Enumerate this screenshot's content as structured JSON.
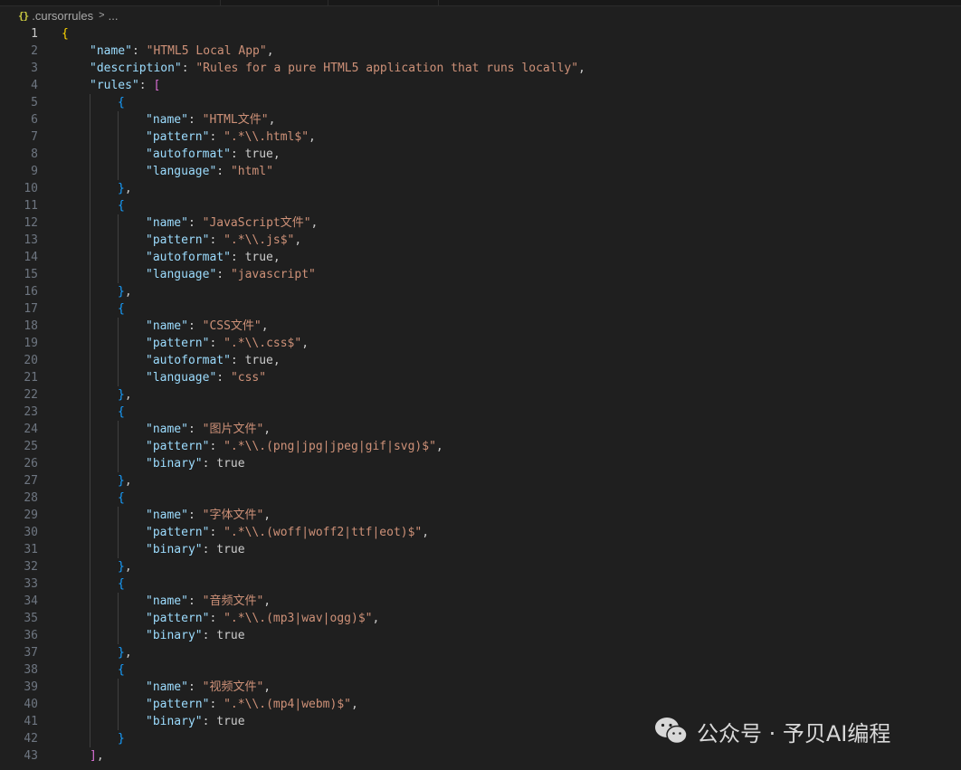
{
  "breadcrumb": {
    "file_icon": "{}",
    "file_name": ".cursorrules",
    "separator_icon": "chevron-right-icon",
    "ellipsis": "..."
  },
  "colors": {
    "background": "#1f1f1f",
    "key": "#9cdcfe",
    "string": "#ce9178",
    "bracket_level1": "#ffd700",
    "bracket_level2": "#da70d6",
    "bracket_level3": "#179fff"
  },
  "editor": {
    "active_line": 1,
    "lines": [
      {
        "n": "1",
        "indent": 0,
        "t": [
          {
            "c": "b1",
            "v": "{"
          }
        ]
      },
      {
        "n": "2",
        "indent": 1,
        "t": [
          {
            "c": "k",
            "v": "\"name\""
          },
          {
            "c": "p",
            "v": ": "
          },
          {
            "c": "s",
            "v": "\"HTML5 Local App\""
          },
          {
            "c": "p",
            "v": ","
          }
        ]
      },
      {
        "n": "3",
        "indent": 1,
        "t": [
          {
            "c": "k",
            "v": "\"description\""
          },
          {
            "c": "p",
            "v": ": "
          },
          {
            "c": "s",
            "v": "\"Rules for a pure HTML5 application that runs locally\""
          },
          {
            "c": "p",
            "v": ","
          }
        ]
      },
      {
        "n": "4",
        "indent": 1,
        "t": [
          {
            "c": "k",
            "v": "\"rules\""
          },
          {
            "c": "p",
            "v": ": "
          },
          {
            "c": "b2",
            "v": "["
          }
        ]
      },
      {
        "n": "5",
        "indent": 2,
        "t": [
          {
            "c": "b3",
            "v": "{"
          }
        ]
      },
      {
        "n": "6",
        "indent": 3,
        "t": [
          {
            "c": "k",
            "v": "\"name\""
          },
          {
            "c": "p",
            "v": ": "
          },
          {
            "c": "s",
            "v": "\"HTML文件\""
          },
          {
            "c": "p",
            "v": ","
          }
        ]
      },
      {
        "n": "7",
        "indent": 3,
        "t": [
          {
            "c": "k",
            "v": "\"pattern\""
          },
          {
            "c": "p",
            "v": ": "
          },
          {
            "c": "s",
            "v": "\".*\\\\.html$\""
          },
          {
            "c": "p",
            "v": ","
          }
        ]
      },
      {
        "n": "8",
        "indent": 3,
        "t": [
          {
            "c": "k",
            "v": "\"autoformat\""
          },
          {
            "c": "p",
            "v": ": "
          },
          {
            "c": "kw",
            "v": "true"
          },
          {
            "c": "p",
            "v": ","
          }
        ]
      },
      {
        "n": "9",
        "indent": 3,
        "t": [
          {
            "c": "k",
            "v": "\"language\""
          },
          {
            "c": "p",
            "v": ": "
          },
          {
            "c": "s",
            "v": "\"html\""
          }
        ]
      },
      {
        "n": "10",
        "indent": 2,
        "t": [
          {
            "c": "b3",
            "v": "}"
          },
          {
            "c": "p",
            "v": ","
          }
        ]
      },
      {
        "n": "11",
        "indent": 2,
        "t": [
          {
            "c": "b3",
            "v": "{"
          }
        ]
      },
      {
        "n": "12",
        "indent": 3,
        "t": [
          {
            "c": "k",
            "v": "\"name\""
          },
          {
            "c": "p",
            "v": ": "
          },
          {
            "c": "s",
            "v": "\"JavaScript文件\""
          },
          {
            "c": "p",
            "v": ","
          }
        ]
      },
      {
        "n": "13",
        "indent": 3,
        "t": [
          {
            "c": "k",
            "v": "\"pattern\""
          },
          {
            "c": "p",
            "v": ": "
          },
          {
            "c": "s",
            "v": "\".*\\\\.js$\""
          },
          {
            "c": "p",
            "v": ","
          }
        ]
      },
      {
        "n": "14",
        "indent": 3,
        "t": [
          {
            "c": "k",
            "v": "\"autoformat\""
          },
          {
            "c": "p",
            "v": ": "
          },
          {
            "c": "kw",
            "v": "true"
          },
          {
            "c": "p",
            "v": ","
          }
        ]
      },
      {
        "n": "15",
        "indent": 3,
        "t": [
          {
            "c": "k",
            "v": "\"language\""
          },
          {
            "c": "p",
            "v": ": "
          },
          {
            "c": "s",
            "v": "\"javascript\""
          }
        ]
      },
      {
        "n": "16",
        "indent": 2,
        "t": [
          {
            "c": "b3",
            "v": "}"
          },
          {
            "c": "p",
            "v": ","
          }
        ]
      },
      {
        "n": "17",
        "indent": 2,
        "t": [
          {
            "c": "b3",
            "v": "{"
          }
        ]
      },
      {
        "n": "18",
        "indent": 3,
        "t": [
          {
            "c": "k",
            "v": "\"name\""
          },
          {
            "c": "p",
            "v": ": "
          },
          {
            "c": "s",
            "v": "\"CSS文件\""
          },
          {
            "c": "p",
            "v": ","
          }
        ]
      },
      {
        "n": "19",
        "indent": 3,
        "t": [
          {
            "c": "k",
            "v": "\"pattern\""
          },
          {
            "c": "p",
            "v": ": "
          },
          {
            "c": "s",
            "v": "\".*\\\\.css$\""
          },
          {
            "c": "p",
            "v": ","
          }
        ]
      },
      {
        "n": "20",
        "indent": 3,
        "t": [
          {
            "c": "k",
            "v": "\"autoformat\""
          },
          {
            "c": "p",
            "v": ": "
          },
          {
            "c": "kw",
            "v": "true"
          },
          {
            "c": "p",
            "v": ","
          }
        ]
      },
      {
        "n": "21",
        "indent": 3,
        "t": [
          {
            "c": "k",
            "v": "\"language\""
          },
          {
            "c": "p",
            "v": ": "
          },
          {
            "c": "s",
            "v": "\"css\""
          }
        ]
      },
      {
        "n": "22",
        "indent": 2,
        "t": [
          {
            "c": "b3",
            "v": "}"
          },
          {
            "c": "p",
            "v": ","
          }
        ]
      },
      {
        "n": "23",
        "indent": 2,
        "t": [
          {
            "c": "b3",
            "v": "{"
          }
        ]
      },
      {
        "n": "24",
        "indent": 3,
        "t": [
          {
            "c": "k",
            "v": "\"name\""
          },
          {
            "c": "p",
            "v": ": "
          },
          {
            "c": "s",
            "v": "\"图片文件\""
          },
          {
            "c": "p",
            "v": ","
          }
        ]
      },
      {
        "n": "25",
        "indent": 3,
        "t": [
          {
            "c": "k",
            "v": "\"pattern\""
          },
          {
            "c": "p",
            "v": ": "
          },
          {
            "c": "s",
            "v": "\".*\\\\.(png|jpg|jpeg|gif|svg)$\""
          },
          {
            "c": "p",
            "v": ","
          }
        ]
      },
      {
        "n": "26",
        "indent": 3,
        "t": [
          {
            "c": "k",
            "v": "\"binary\""
          },
          {
            "c": "p",
            "v": ": "
          },
          {
            "c": "kw",
            "v": "true"
          }
        ]
      },
      {
        "n": "27",
        "indent": 2,
        "t": [
          {
            "c": "b3",
            "v": "}"
          },
          {
            "c": "p",
            "v": ","
          }
        ]
      },
      {
        "n": "28",
        "indent": 2,
        "t": [
          {
            "c": "b3",
            "v": "{"
          }
        ]
      },
      {
        "n": "29",
        "indent": 3,
        "t": [
          {
            "c": "k",
            "v": "\"name\""
          },
          {
            "c": "p",
            "v": ": "
          },
          {
            "c": "s",
            "v": "\"字体文件\""
          },
          {
            "c": "p",
            "v": ","
          }
        ]
      },
      {
        "n": "30",
        "indent": 3,
        "t": [
          {
            "c": "k",
            "v": "\"pattern\""
          },
          {
            "c": "p",
            "v": ": "
          },
          {
            "c": "s",
            "v": "\".*\\\\.(woff|woff2|ttf|eot)$\""
          },
          {
            "c": "p",
            "v": ","
          }
        ]
      },
      {
        "n": "31",
        "indent": 3,
        "t": [
          {
            "c": "k",
            "v": "\"binary\""
          },
          {
            "c": "p",
            "v": ": "
          },
          {
            "c": "kw",
            "v": "true"
          }
        ]
      },
      {
        "n": "32",
        "indent": 2,
        "t": [
          {
            "c": "b3",
            "v": "}"
          },
          {
            "c": "p",
            "v": ","
          }
        ]
      },
      {
        "n": "33",
        "indent": 2,
        "t": [
          {
            "c": "b3",
            "v": "{"
          }
        ]
      },
      {
        "n": "34",
        "indent": 3,
        "t": [
          {
            "c": "k",
            "v": "\"name\""
          },
          {
            "c": "p",
            "v": ": "
          },
          {
            "c": "s",
            "v": "\"音频文件\""
          },
          {
            "c": "p",
            "v": ","
          }
        ]
      },
      {
        "n": "35",
        "indent": 3,
        "t": [
          {
            "c": "k",
            "v": "\"pattern\""
          },
          {
            "c": "p",
            "v": ": "
          },
          {
            "c": "s",
            "v": "\".*\\\\.(mp3|wav|ogg)$\""
          },
          {
            "c": "p",
            "v": ","
          }
        ]
      },
      {
        "n": "36",
        "indent": 3,
        "t": [
          {
            "c": "k",
            "v": "\"binary\""
          },
          {
            "c": "p",
            "v": ": "
          },
          {
            "c": "kw",
            "v": "true"
          }
        ]
      },
      {
        "n": "37",
        "indent": 2,
        "t": [
          {
            "c": "b3",
            "v": "}"
          },
          {
            "c": "p",
            "v": ","
          }
        ]
      },
      {
        "n": "38",
        "indent": 2,
        "t": [
          {
            "c": "b3",
            "v": "{"
          }
        ]
      },
      {
        "n": "39",
        "indent": 3,
        "t": [
          {
            "c": "k",
            "v": "\"name\""
          },
          {
            "c": "p",
            "v": ": "
          },
          {
            "c": "s",
            "v": "\"视频文件\""
          },
          {
            "c": "p",
            "v": ","
          }
        ]
      },
      {
        "n": "40",
        "indent": 3,
        "t": [
          {
            "c": "k",
            "v": "\"pattern\""
          },
          {
            "c": "p",
            "v": ": "
          },
          {
            "c": "s",
            "v": "\".*\\\\.(mp4|webm)$\""
          },
          {
            "c": "p",
            "v": ","
          }
        ]
      },
      {
        "n": "41",
        "indent": 3,
        "t": [
          {
            "c": "k",
            "v": "\"binary\""
          },
          {
            "c": "p",
            "v": ": "
          },
          {
            "c": "kw",
            "v": "true"
          }
        ]
      },
      {
        "n": "42",
        "indent": 2,
        "t": [
          {
            "c": "b3",
            "v": "}"
          }
        ]
      },
      {
        "n": "43",
        "indent": 1,
        "t": [
          {
            "c": "b2",
            "v": "]"
          },
          {
            "c": "p",
            "v": ","
          }
        ]
      }
    ]
  },
  "watermark": {
    "icon": "wechat-icon",
    "text": "公众号 · 予贝AI编程"
  }
}
